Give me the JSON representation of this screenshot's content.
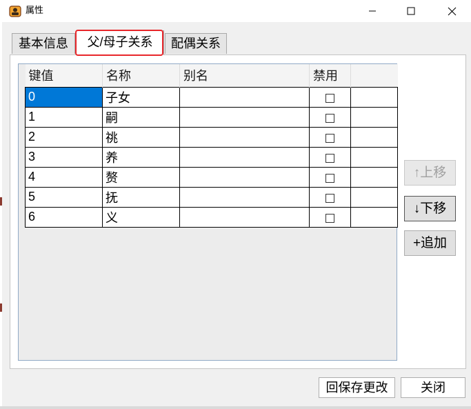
{
  "window": {
    "title": "属性",
    "controls": {
      "minimize": "─",
      "maximize": "☐",
      "close": "✕"
    }
  },
  "tabs": [
    {
      "label": "基本信息",
      "active": false
    },
    {
      "label": "父/母子关系",
      "active": true
    },
    {
      "label": "配偶关系",
      "active": false
    }
  ],
  "grid": {
    "columns": [
      "键值",
      "名称",
      "别名",
      "禁用",
      ""
    ],
    "rows": [
      {
        "key": "0",
        "name": "子女",
        "alias": "",
        "disabled": false
      },
      {
        "key": "1",
        "name": "嗣",
        "alias": "",
        "disabled": false
      },
      {
        "key": "2",
        "name": "祧",
        "alias": "",
        "disabled": false
      },
      {
        "key": "3",
        "name": "养",
        "alias": "",
        "disabled": false
      },
      {
        "key": "4",
        "name": "赘",
        "alias": "",
        "disabled": false
      },
      {
        "key": "5",
        "name": "抚",
        "alias": "",
        "disabled": false
      },
      {
        "key": "6",
        "name": "义",
        "alias": "",
        "disabled": false
      }
    ],
    "selected_row": 0
  },
  "side_buttons": {
    "move_up": "↑上移",
    "move_down": "↓下移",
    "append": "+追加"
  },
  "footer": {
    "save": "回保存更改",
    "close": "关闭"
  },
  "colors": {
    "selection": "#0078d7",
    "highlight_border": "#e8262a",
    "grid_border": "#8fa9c6"
  }
}
